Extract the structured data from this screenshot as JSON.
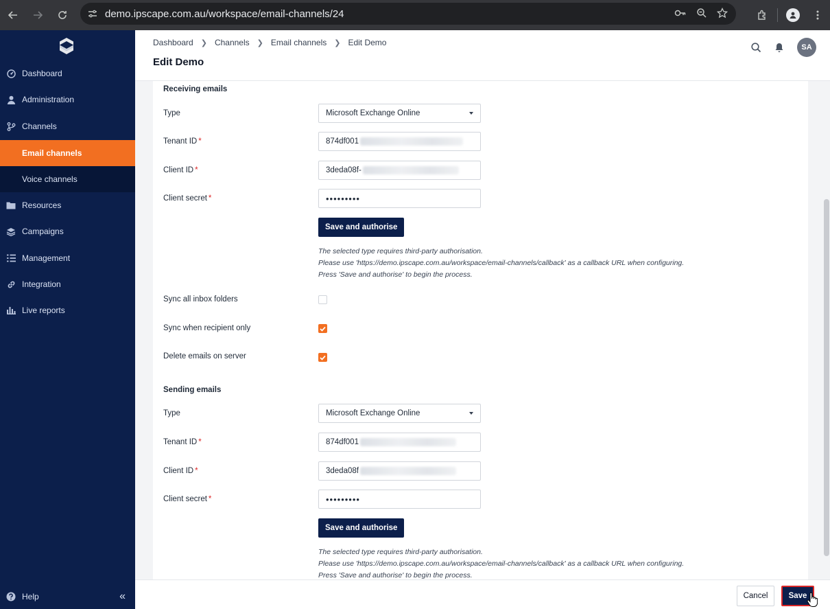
{
  "browser": {
    "url": "demo.ipscape.com.au/workspace/email-channels/24"
  },
  "sidebar": {
    "items": [
      {
        "label": "Dashboard",
        "icon": "dashboard-icon"
      },
      {
        "label": "Administration",
        "icon": "user-icon"
      },
      {
        "label": "Channels",
        "icon": "channels-icon"
      },
      {
        "label": "Email channels",
        "icon": "",
        "active": true
      },
      {
        "label": "Voice channels",
        "icon": ""
      },
      {
        "label": "Resources",
        "icon": "folder-icon"
      },
      {
        "label": "Campaigns",
        "icon": "layers-icon"
      },
      {
        "label": "Management",
        "icon": "list-icon"
      },
      {
        "label": "Integration",
        "icon": "link-icon"
      },
      {
        "label": "Live reports",
        "icon": "bar-chart-icon"
      }
    ],
    "help_label": "Help",
    "active_color": "#f26f21",
    "bg_color": "#0c1f4b"
  },
  "header": {
    "breadcrumbs": [
      "Dashboard",
      "Channels",
      "Email channels",
      "Edit Demo"
    ],
    "title": "Edit Demo",
    "avatar_initials": "SA"
  },
  "receiving": {
    "title": "Receiving emails",
    "type_label": "Type",
    "type_value": "Microsoft Exchange Online",
    "tenant_label": "Tenant ID",
    "tenant_value": "874df001",
    "client_label": "Client ID",
    "client_value": "3deda08f-",
    "secret_label": "Client secret",
    "secret_value": "•••••••••",
    "authorise_label": "Save and authorise",
    "note_lines": [
      "The selected type requires third-party authorisation.",
      "Please use 'https://demo.ipscape.com.au/workspace/email-channels/callback' as a callback URL when configuring.",
      "Press 'Save and authorise' to begin the process."
    ],
    "sync_all_label": "Sync all inbox folders",
    "sync_all_checked": false,
    "sync_recipient_label": "Sync when recipient only",
    "sync_recipient_checked": true,
    "delete_label": "Delete emails on server",
    "delete_checked": true
  },
  "sending": {
    "title": "Sending emails",
    "type_label": "Type",
    "type_value": "Microsoft Exchange Online",
    "tenant_label": "Tenant ID",
    "tenant_value": "874df001",
    "client_label": "Client ID",
    "client_value": "3deda08f",
    "secret_label": "Client secret",
    "secret_value": "•••••••••",
    "authorise_label": "Save and authorise",
    "note_lines": [
      "The selected type requires third-party authorisation.",
      "Please use 'https://demo.ipscape.com.au/workspace/email-channels/callback' as a callback URL when configuring.",
      "Press 'Save and authorise' to begin the process."
    ]
  },
  "footer": {
    "cancel_label": "Cancel",
    "save_label": "Save"
  }
}
